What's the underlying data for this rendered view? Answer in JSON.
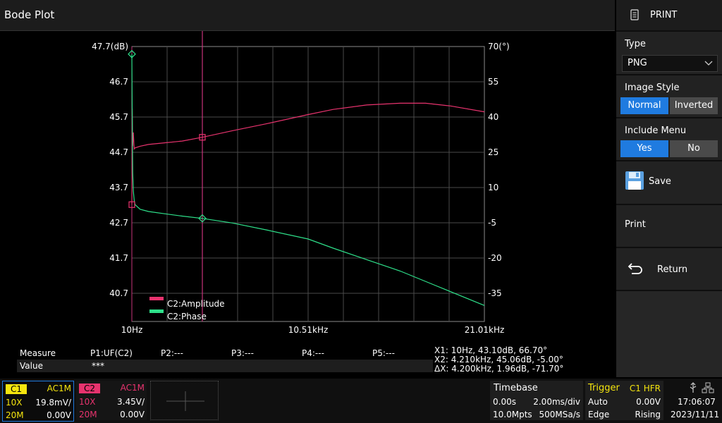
{
  "title": "Bode Plot",
  "menu": {
    "print_label": "PRINT",
    "type_label": "Type",
    "type_value": "PNG",
    "image_style_label": "Image Style",
    "image_style_options": [
      "Normal",
      "Inverted"
    ],
    "image_style_selected": "Normal",
    "include_menu_label": "Include Menu",
    "include_menu_options": [
      "Yes",
      "No"
    ],
    "include_menu_selected": "Yes",
    "save_label": "Save",
    "print_action_label": "Print",
    "return_label": "Return"
  },
  "chart_data": {
    "type": "line",
    "x_unit_labels": [
      "10Hz",
      "10.51kHz",
      "21.01kHz"
    ],
    "xlim": [
      10,
      21010
    ],
    "y_left_ticks": [
      "47.7(dB)",
      "46.7",
      "45.7",
      "44.7",
      "43.7",
      "42.7",
      "41.7",
      "40.7"
    ],
    "y_left_range": [
      39.7,
      47.7
    ],
    "y_right_ticks": [
      "70(°)",
      "55",
      "40",
      "25",
      "10",
      "-5",
      "-20",
      "-35"
    ],
    "y_right_range": [
      -50,
      70
    ],
    "series": [
      {
        "name": "C2:Amplitude",
        "color": "#e8336e",
        "axis": "left",
        "x": [
          10,
          30,
          60,
          100,
          150,
          200,
          500,
          1000,
          2000,
          3000,
          4210,
          6000,
          8000,
          10510,
          12000,
          14000,
          16000,
          17500,
          19000,
          21010
        ],
        "y": [
          43.1,
          45.9,
          44.8,
          45.2,
          44.72,
          44.75,
          44.8,
          44.85,
          44.9,
          44.95,
          45.06,
          45.25,
          45.45,
          45.72,
          45.87,
          46.0,
          46.05,
          46.05,
          45.97,
          45.8
        ]
      },
      {
        "name": "C2:Phase",
        "color": "#2ee08a",
        "axis": "right",
        "x": [
          10,
          30,
          60,
          100,
          150,
          200,
          500,
          1000,
          2000,
          3000,
          4210,
          6000,
          8000,
          10510,
          12000,
          14000,
          16000,
          18000,
          21010
        ],
        "y": [
          66.7,
          40,
          15,
          7,
          3,
          1,
          -1,
          -2,
          -3,
          -4,
          -5,
          -7,
          -10,
          -14,
          -18,
          -23,
          -28,
          -34,
          -43
        ]
      }
    ],
    "cursor": {
      "x1": 10,
      "x2": 4210
    }
  },
  "measure": {
    "label": "Measure",
    "value_label": "Value",
    "p1": "P1:UF(C2)",
    "p2": "P2:---",
    "p3": "P3:---",
    "p4": "P4:---",
    "p5": "P5:---",
    "value": "***",
    "x1": "X1: 10Hz, 43.10dB, 66.70°",
    "x2": "X2: 4.210kHz, 45.06dB, -5.00°",
    "dx": "ΔX: 4.200kHz, 1.96dB, -71.70°"
  },
  "status": {
    "c1": {
      "name": "C1",
      "coupling": "AC1M",
      "probe": "10X",
      "scale": "19.8mV/",
      "bw": "20M",
      "offset": "0.00V"
    },
    "c2": {
      "name": "C2",
      "coupling": "AC1M",
      "probe": "10X",
      "scale": "3.45V/",
      "bw": "20M",
      "offset": "0.00V"
    },
    "timebase": {
      "label": "Timebase",
      "delay": "0.00s",
      "scale": "2.00ms/div",
      "memory": "10.0Mpts",
      "rate": "500MSa/s"
    },
    "trigger": {
      "label": "Trigger",
      "source": "C1 HFR",
      "mode": "Auto",
      "level": "0.00V",
      "type": "Edge",
      "slope": "Rising"
    },
    "time": "17:06:07",
    "date": "2023/11/11"
  },
  "colors": {
    "c1": "#f5e50e",
    "c2": "#e8336e",
    "accent": "#1f7be0"
  }
}
